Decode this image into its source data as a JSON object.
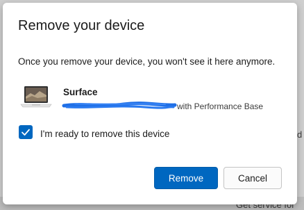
{
  "background": {
    "partial_text_right": "d",
    "partial_text_bottom": "Get service for"
  },
  "dialog": {
    "title": "Remove your device",
    "description": "Once you remove your device, you won't see it here anymore.",
    "device": {
      "name": "Surface",
      "model_visible_suffix": "with Performance Base",
      "icon": "surface-laptop-thumbnail"
    },
    "confirm_checkbox": {
      "label": "I'm ready to remove this device",
      "checked": true
    },
    "buttons": {
      "remove": "Remove",
      "cancel": "Cancel"
    }
  },
  "colors": {
    "accent": "#0067c0",
    "redaction": "#1f6fe6"
  }
}
